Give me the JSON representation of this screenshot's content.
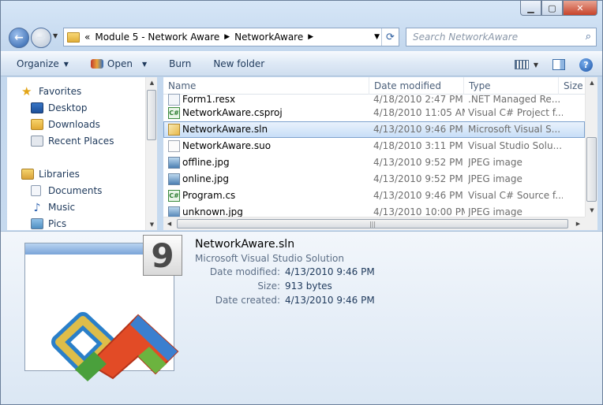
{
  "nav": {
    "breadcrumb_overflow": "«",
    "breadcrumb": [
      "Module 5 - Network Aware",
      "NetworkAware"
    ],
    "search_placeholder": "Search NetworkAware"
  },
  "toolbar": {
    "organize": "Organize",
    "open": "Open",
    "burn": "Burn",
    "new_folder": "New folder"
  },
  "sidebar": {
    "favorites_label": "Favorites",
    "favorites": [
      "Desktop",
      "Downloads",
      "Recent Places"
    ],
    "libraries_label": "Libraries",
    "libraries": [
      "Documents",
      "Music",
      "Pics"
    ]
  },
  "columns": {
    "name": "Name",
    "date": "Date modified",
    "type": "Type",
    "size": "Size"
  },
  "files": [
    {
      "name": "Form1.resx",
      "date": "4/18/2010 2:47 PM",
      "type": ".NET Managed Re...",
      "icon": "resx-file-icon"
    },
    {
      "name": "NetworkAware.csproj",
      "date": "4/18/2010 11:05 AM",
      "type": "Visual C# Project f...",
      "icon": "csharp-project-icon"
    },
    {
      "name": "NetworkAware.sln",
      "date": "4/13/2010 9:46 PM",
      "type": "Microsoft Visual S...",
      "icon": "solution-file-icon",
      "selected": true
    },
    {
      "name": "NetworkAware.suo",
      "date": "4/18/2010 3:11 PM",
      "type": "Visual Studio Solu...",
      "icon": "suo-file-icon"
    },
    {
      "name": "offline.jpg",
      "date": "4/13/2010 9:52 PM",
      "type": "JPEG image",
      "icon": "jpeg-file-icon"
    },
    {
      "name": "online.jpg",
      "date": "4/13/2010 9:52 PM",
      "type": "JPEG image",
      "icon": "jpeg-file-icon"
    },
    {
      "name": "Program.cs",
      "date": "4/13/2010 9:46 PM",
      "type": "Visual C# Source f...",
      "icon": "csharp-source-icon"
    },
    {
      "name": "unknown.jpg",
      "date": "4/13/2010 10:00 PM",
      "type": "JPEG image",
      "icon": "jpeg-file-icon"
    }
  ],
  "details": {
    "badge": "9",
    "name": "NetworkAware.sln",
    "type": "Microsoft Visual Studio Solution",
    "date_modified_label": "Date modified:",
    "date_modified": "4/13/2010 9:46 PM",
    "size_label": "Size:",
    "size": "913 bytes",
    "date_created_label": "Date created:",
    "date_created": "4/13/2010 9:46 PM"
  }
}
